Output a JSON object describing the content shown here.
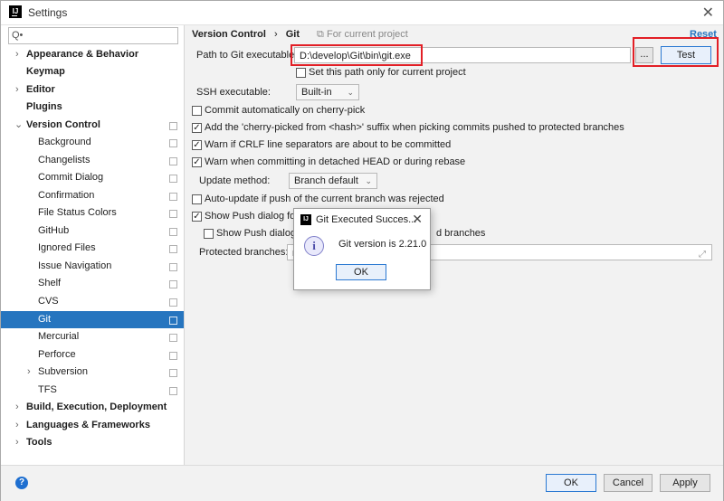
{
  "window": {
    "title": "Settings"
  },
  "search": {
    "placeholder": "Q•"
  },
  "sidebar": {
    "items": [
      {
        "label": "Appearance & Behavior"
      },
      {
        "label": "Keymap"
      },
      {
        "label": "Editor"
      },
      {
        "label": "Plugins"
      },
      {
        "label": "Version Control"
      },
      {
        "label": "Background"
      },
      {
        "label": "Changelists"
      },
      {
        "label": "Commit Dialog"
      },
      {
        "label": "Confirmation"
      },
      {
        "label": "File Status Colors"
      },
      {
        "label": "GitHub"
      },
      {
        "label": "Ignored Files"
      },
      {
        "label": "Issue Navigation"
      },
      {
        "label": "Shelf"
      },
      {
        "label": "CVS"
      },
      {
        "label": "Git"
      },
      {
        "label": "Mercurial"
      },
      {
        "label": "Perforce"
      },
      {
        "label": "Subversion"
      },
      {
        "label": "TFS"
      },
      {
        "label": "Build, Execution, Deployment"
      },
      {
        "label": "Languages & Frameworks"
      },
      {
        "label": "Tools"
      }
    ]
  },
  "breadcrumb": {
    "parent": "Version Control",
    "separator": "›",
    "current": "Git",
    "note": "For current project"
  },
  "reset_label": "Reset",
  "git": {
    "path_label": "Path to Git executable:",
    "path_value": "D:\\develop\\Git\\bin\\git.exe",
    "browse_label": "...",
    "test_label": "Test",
    "set_path_label": "Set this path only for current project",
    "ssh_label": "SSH executable:",
    "ssh_value": "Built-in",
    "commit_auto_label": "Commit automatically on cherry-pick",
    "cherry_pick_label": "Add the 'cherry-picked from <hash>' suffix when picking commits pushed to protected branches",
    "crlf_label": "Warn if CRLF line separators are about to be committed",
    "detached_label": "Warn when committing in detached HEAD or during rebase",
    "update_method_label": "Update method:",
    "update_method_value": "Branch default",
    "auto_update_label": "Auto-update if push of the current branch was rejected",
    "show_push_label": "Show Push dialog for",
    "show_push_sub_label": "Show Push dialog o",
    "show_push_sub_tail": "d branches",
    "protected_label": "Protected branches:",
    "protected_value": "m"
  },
  "footer": {
    "ok_label": "OK",
    "cancel_label": "Cancel",
    "apply_label": "Apply"
  },
  "dialog": {
    "title": "Git Executed Succes...",
    "message": "Git version is 2.21.0",
    "ok_label": "OK"
  },
  "colors": {
    "selection": "#2675bf",
    "highlight": "#e21f26",
    "link": "#2675bf"
  },
  "icons": {
    "app": "intellij-icon",
    "info": "info-icon",
    "help": "help-icon"
  }
}
